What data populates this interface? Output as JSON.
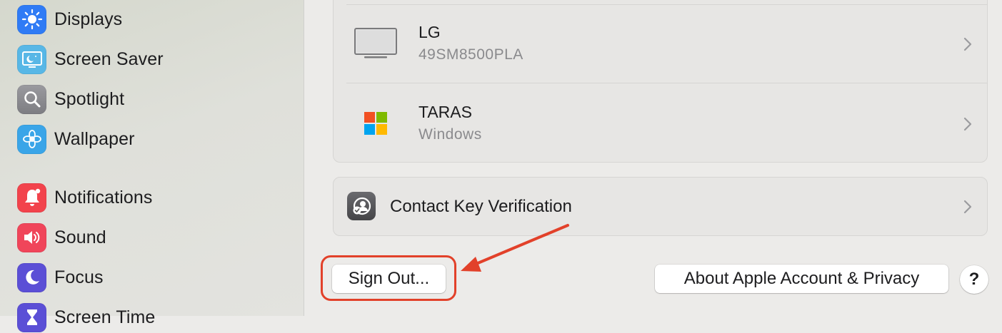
{
  "sidebar": {
    "items": [
      {
        "label": "Displays",
        "icon": "displays-icon",
        "color": "#2f7bf5"
      },
      {
        "label": "Screen Saver",
        "icon": "screen-saver-icon",
        "color": "#58b7e6"
      },
      {
        "label": "Spotlight",
        "icon": "spotlight-icon",
        "color": "#8e8e93"
      },
      {
        "label": "Wallpaper",
        "icon": "wallpaper-icon",
        "color": "#3aa5e8"
      },
      {
        "label": "Notifications",
        "icon": "notifications-icon",
        "color": "#f2434c"
      },
      {
        "label": "Sound",
        "icon": "sound-icon",
        "color": "#f0455a"
      },
      {
        "label": "Focus",
        "icon": "focus-icon",
        "color": "#5b4fd6"
      },
      {
        "label": "Screen Time",
        "icon": "screen-time-icon",
        "color": "#5b4fd6"
      }
    ]
  },
  "devices": [
    {
      "name": "LG",
      "detail": "49SM8500PLA",
      "icon": "monitor-icon"
    },
    {
      "name": "TARAS",
      "detail": "Windows",
      "icon": "windows-logo-icon"
    }
  ],
  "contact_key": {
    "label": "Contact Key Verification",
    "icon": "contact-key-verification-icon"
  },
  "buttons": {
    "sign_out": "Sign Out...",
    "about": "About Apple Account & Privacy",
    "help": "?"
  },
  "annotation": {
    "color": "#e2412a"
  }
}
